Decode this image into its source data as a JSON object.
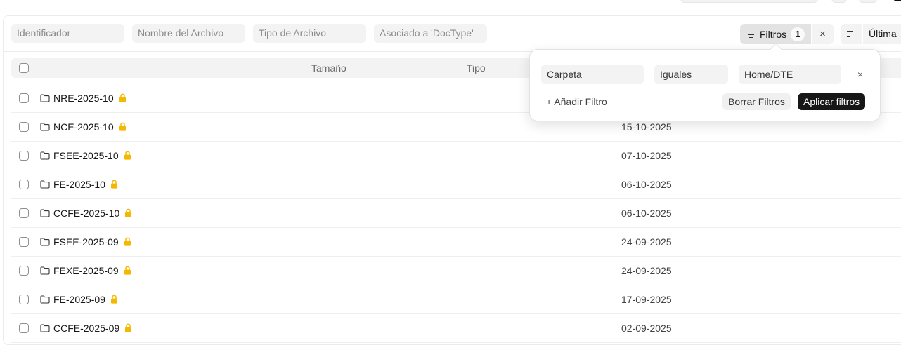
{
  "filters": {
    "identifier_placeholder": "Identificador",
    "filename_placeholder": "Nombre del Archivo",
    "filetype_placeholder": "Tipo de Archivo",
    "doctype_placeholder": "Asociado a 'DocType'"
  },
  "toolbar": {
    "filter_label": "Filtros",
    "filter_count": "1",
    "clear_filter_symbol": "×",
    "sort_label": "Última"
  },
  "table": {
    "columns": {
      "size": "Tamaño",
      "type": "Tipo"
    },
    "rows": [
      {
        "name": "NRE-2025-10",
        "date": ""
      },
      {
        "name": "NCE-2025-10",
        "date": "15-10-2025"
      },
      {
        "name": "FSEE-2025-10",
        "date": "07-10-2025"
      },
      {
        "name": "FE-2025-10",
        "date": "06-10-2025"
      },
      {
        "name": "CCFE-2025-10",
        "date": "06-10-2025"
      },
      {
        "name": "FSEE-2025-09",
        "date": "24-09-2025"
      },
      {
        "name": "FEXE-2025-09",
        "date": "24-09-2025"
      },
      {
        "name": "FE-2025-09",
        "date": "17-09-2025"
      },
      {
        "name": "CCFE-2025-09",
        "date": "02-09-2025"
      }
    ]
  },
  "popover": {
    "field": "Carpeta",
    "operator": "Iguales",
    "value": "Home/DTE",
    "remove_symbol": "×",
    "add_filter": "+ Añadir Filtro",
    "clear_filters": "Borrar Filtros",
    "apply_filters": "Aplicar filtros"
  },
  "icons": {
    "row_icon": "folder-icon",
    "lock": "lock-icon",
    "filter": "filter-icon",
    "sort": "sort-direction-icon"
  },
  "colors": {
    "lock": "#f5b800",
    "apply_button_bg": "#171717",
    "filter_button_bg": "#e3e3e3"
  }
}
